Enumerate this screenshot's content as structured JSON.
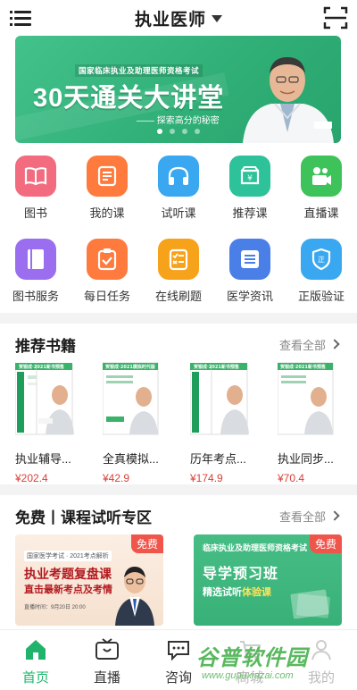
{
  "header": {
    "title": "执业医师"
  },
  "banner": {
    "subtitle": "国家临床执业及助理医师资格考试",
    "main": "30天通关大讲堂",
    "tagline": "—— 探索高分的秘密",
    "dots": 4,
    "active_dot": 0
  },
  "grid": [
    {
      "label": "图书",
      "icon": "book-icon",
      "color": "#f26b7f"
    },
    {
      "label": "我的课",
      "icon": "my-course-icon",
      "color": "#ff7a3d"
    },
    {
      "label": "试听课",
      "icon": "headphones-icon",
      "color": "#3aa8f0"
    },
    {
      "label": "推荐课",
      "icon": "recommend-icon",
      "color": "#2ec29a"
    },
    {
      "label": "直播课",
      "icon": "live-icon",
      "color": "#3ec35a"
    },
    {
      "label": "图书服务",
      "icon": "book-service-icon",
      "color": "#9b6ef0"
    },
    {
      "label": "每日任务",
      "icon": "task-icon",
      "color": "#ff7a3d"
    },
    {
      "label": "在线刷题",
      "icon": "quiz-icon",
      "color": "#f7a21b"
    },
    {
      "label": "医学资讯",
      "icon": "news-icon",
      "color": "#4a7fe8"
    },
    {
      "label": "正版验证",
      "icon": "verify-shield-icon",
      "color": "#3aa8f0"
    }
  ],
  "books_section": {
    "title": "推荐书籍",
    "more": "查看全部",
    "items": [
      {
        "name": "执业辅导...",
        "price": "¥202.4",
        "cover_tag": "贺银成 · 2021新书预售"
      },
      {
        "name": "全真模拟...",
        "price": "¥42.9",
        "cover_tag": "贺银成 · 2021模拟时代版"
      },
      {
        "name": "历年考点...",
        "price": "¥174.9",
        "cover_tag": "贺银成 · 2021新书预售"
      },
      {
        "name": "执业同步...",
        "price": "¥70.4",
        "cover_tag": "贺银成 · 2021新书预售"
      }
    ]
  },
  "course_section": {
    "title": "免费丨课程试听专区",
    "more": "查看全部",
    "card1": {
      "badge": "免费",
      "small": "国家医学考试 · 2021考点解析",
      "line1": "执业考题复盘课",
      "line2": "直击最新考点及考情",
      "line3": "直播时间：9月20日 20:00"
    },
    "card2": {
      "badge": "免费",
      "line1": "临床执业及助理医师资格考试",
      "line2": "导学预习班",
      "line3a": "精选试听",
      "line3b": "体验课"
    }
  },
  "tabs": [
    {
      "label": "首页",
      "icon": "home-icon",
      "active": true
    },
    {
      "label": "直播",
      "icon": "tv-icon",
      "active": false
    },
    {
      "label": "咨询",
      "icon": "chat-icon",
      "active": false
    },
    {
      "label": "商城",
      "icon": "cart-icon",
      "active": false
    },
    {
      "label": "我的",
      "icon": "user-icon",
      "active": false
    }
  ],
  "watermark": {
    "main": "谷普软件园",
    "url": "www.gupuxiazai.com"
  }
}
